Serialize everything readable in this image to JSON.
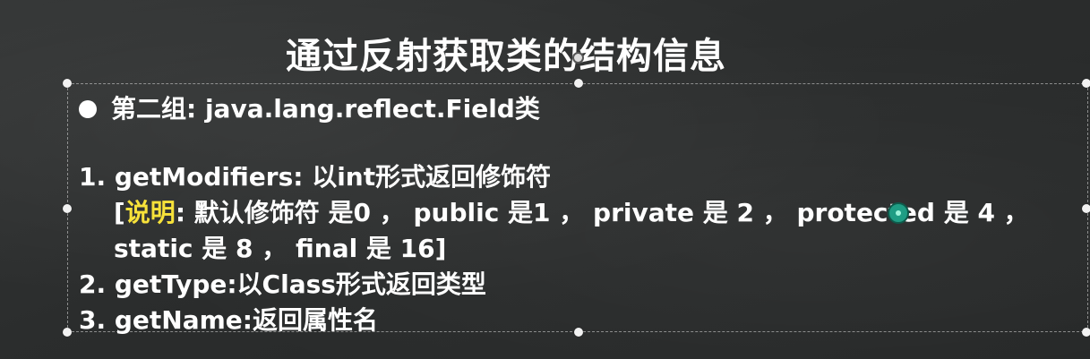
{
  "slide": {
    "title": "通过反射获取类的结构信息",
    "bullet_heading": "第二组: java.lang.reflect.Field类",
    "items": {
      "item1": "1. getModifiers: 以int形式返回修饰符",
      "note_open": "[",
      "note_label": "说明",
      "note_rest": ": 默认修饰符 是0 ， public  是1 ， private 是 2 ， protected 是 4 ，",
      "note_line2": "static 是 8 ， final 是 16]",
      "item2": "2. getType:以Class形式返回类型",
      "item3": "3. getName:返回属性名"
    }
  },
  "colors": {
    "background": "#2a2c2c",
    "text": "#ffffff",
    "highlight": "#f7e23a"
  }
}
